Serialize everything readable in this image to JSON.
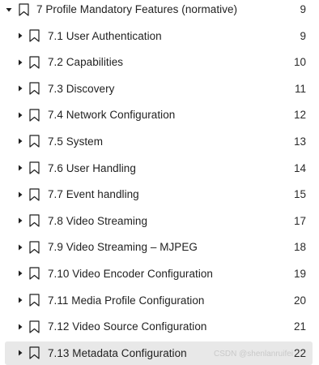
{
  "outline": {
    "root": {
      "title": "7 Profile Mandatory Features (normative)",
      "page": "9",
      "expanded": true,
      "toggle_icon": "chevron-down-icon",
      "bookmark_icon": "bookmark-icon"
    },
    "items": [
      {
        "title": "7.1 User Authentication",
        "page": "9"
      },
      {
        "title": "7.2 Capabilities",
        "page": "10"
      },
      {
        "title": "7.3 Discovery",
        "page": "11"
      },
      {
        "title": "7.4 Network Configuration",
        "page": "12"
      },
      {
        "title": "7.5 System",
        "page": "13"
      },
      {
        "title": "7.6 User Handling",
        "page": "14"
      },
      {
        "title": "7.7 Event handling",
        "page": "15"
      },
      {
        "title": "7.8 Video Streaming",
        "page": "17"
      },
      {
        "title": "7.9 Video Streaming – MJPEG",
        "page": "18"
      },
      {
        "title": "7.10 Video Encoder Configuration",
        "page": "19"
      },
      {
        "title": "7.11 Media Profile Configuration",
        "page": "20"
      },
      {
        "title": "7.12 Video Source Configuration",
        "page": "21"
      },
      {
        "title": "7.13 Metadata Configuration",
        "page": "22",
        "selected": true
      }
    ],
    "child_toggle_icon": "chevron-right-icon",
    "selected_background": "#e8e8e8"
  },
  "watermark": "CSDN @shenlanruifei"
}
